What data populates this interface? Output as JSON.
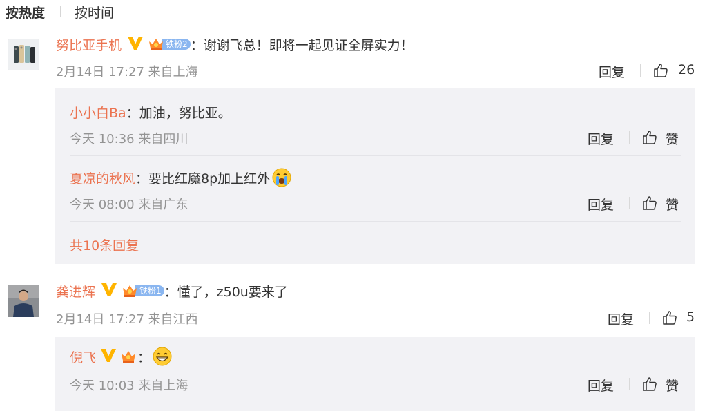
{
  "sort": {
    "hot": "按热度",
    "time": "按时间"
  },
  "comments": [
    {
      "user": "努比亚手机",
      "badge": "铁粉2",
      "text": "：谢谢飞总！即将一起见证全屏实力！",
      "meta": "2月14日 17:27 来自上海",
      "reply": "回复",
      "likes": "26",
      "replies": [
        {
          "user": "小小白Ba",
          "text": "：加油，努比亚。",
          "meta": "今天 10:36 来自四川",
          "reply": "回复",
          "like_label": "赞"
        },
        {
          "user": "夏凉的秋风",
          "text": "：要比红魔8p加上红外",
          "emoji": "crying-face-icon",
          "meta": "今天 08:00 来自广东",
          "reply": "回复",
          "like_label": "赞"
        }
      ],
      "more": "共10条回复"
    },
    {
      "user": "龚进辉",
      "badge": "铁粉1",
      "text": "：懂了，z50u要来了",
      "meta": "2月14日 17:27 来自江西",
      "reply": "回复",
      "likes": "5",
      "replies": [
        {
          "user": "倪飞",
          "text": "：",
          "emoji": "grinning-face-icon",
          "meta": "今天 10:03 来自上海",
          "reply": "回复",
          "like_label": "赞"
        }
      ]
    }
  ],
  "colors": {
    "username": "#eb7350",
    "verified": "#ffb400",
    "badge": "#8ab6f0",
    "panel": "#f2f2f5",
    "meta": "#939393"
  }
}
